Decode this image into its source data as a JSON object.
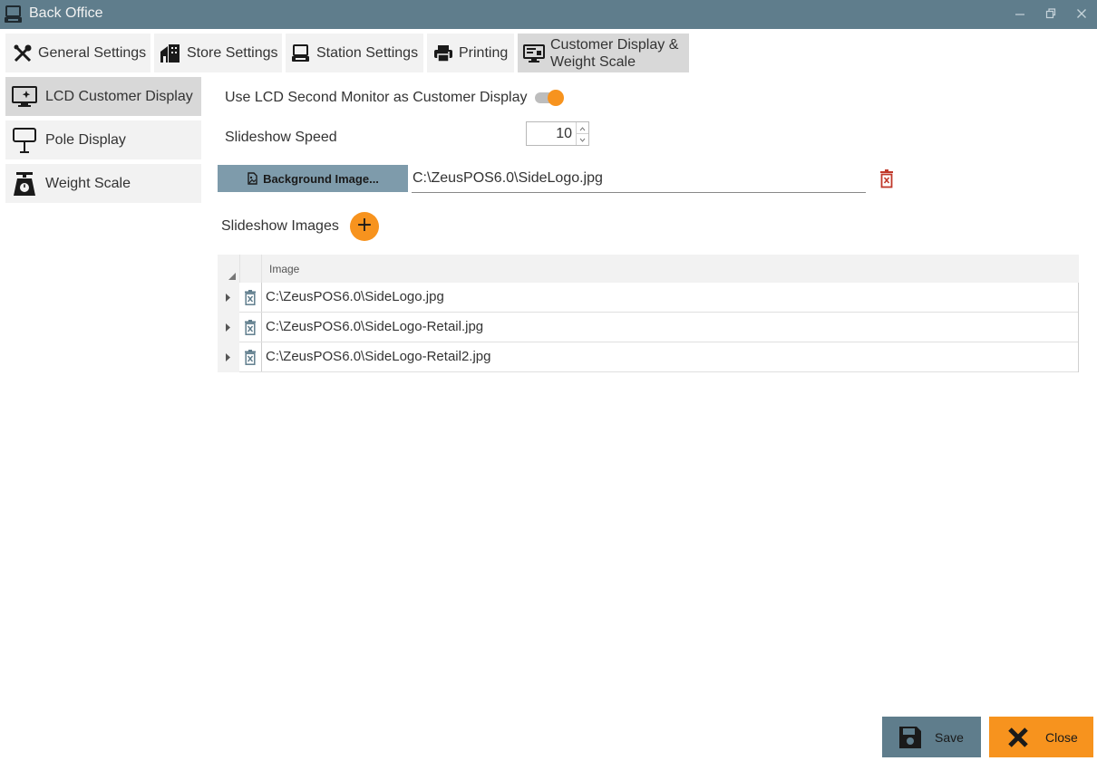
{
  "window": {
    "title": "Back Office",
    "controls": [
      "minimize-icon",
      "restore-icon",
      "close-icon"
    ]
  },
  "tabs": [
    {
      "label": "General Settings",
      "icon": "tools-icon",
      "active": false
    },
    {
      "label": "Store Settings",
      "icon": "store-building-icon",
      "active": false
    },
    {
      "label": "Station Settings",
      "icon": "pos-terminal-icon",
      "active": false
    },
    {
      "label": "Printing",
      "icon": "printer-icon",
      "active": false
    },
    {
      "label_line1": "Customer Display &",
      "label_line2": "Weight Scale",
      "icon": "customer-display-icon",
      "active": true
    }
  ],
  "sidebar": {
    "items": [
      {
        "label": "LCD Customer Display",
        "icon": "lcd-monitor-icon",
        "active": true
      },
      {
        "label": "Pole Display",
        "icon": "pole-display-icon",
        "active": false
      },
      {
        "label": "Weight Scale",
        "icon": "weight-scale-icon",
        "active": false
      }
    ]
  },
  "lcd": {
    "use_second_monitor_label": "Use LCD Second Monitor as Customer Display",
    "use_second_monitor_on": true,
    "slideshow_speed_label": "Slideshow Speed",
    "slideshow_speed_value": "10",
    "background_button_label": "Background Image...",
    "background_path": "C:\\ZeusPOS6.0\\SideLogo.jpg",
    "slideshow_images_label": "Slideshow Images",
    "add_label": "+"
  },
  "grid": {
    "column_header": "Image",
    "rows": [
      {
        "image": "C:\\ZeusPOS6.0\\SideLogo.jpg"
      },
      {
        "image": "C:\\ZeusPOS6.0\\SideLogo-Retail.jpg"
      },
      {
        "image": "C:\\ZeusPOS6.0\\SideLogo-Retail2.jpg"
      }
    ]
  },
  "footer": {
    "save_label": "Save",
    "close_label": "Close"
  },
  "colors": {
    "titlebar": "#5f7d8c",
    "accent": "#f7931e",
    "button_blue": "#7e9bab",
    "danger": "#c0392b"
  }
}
